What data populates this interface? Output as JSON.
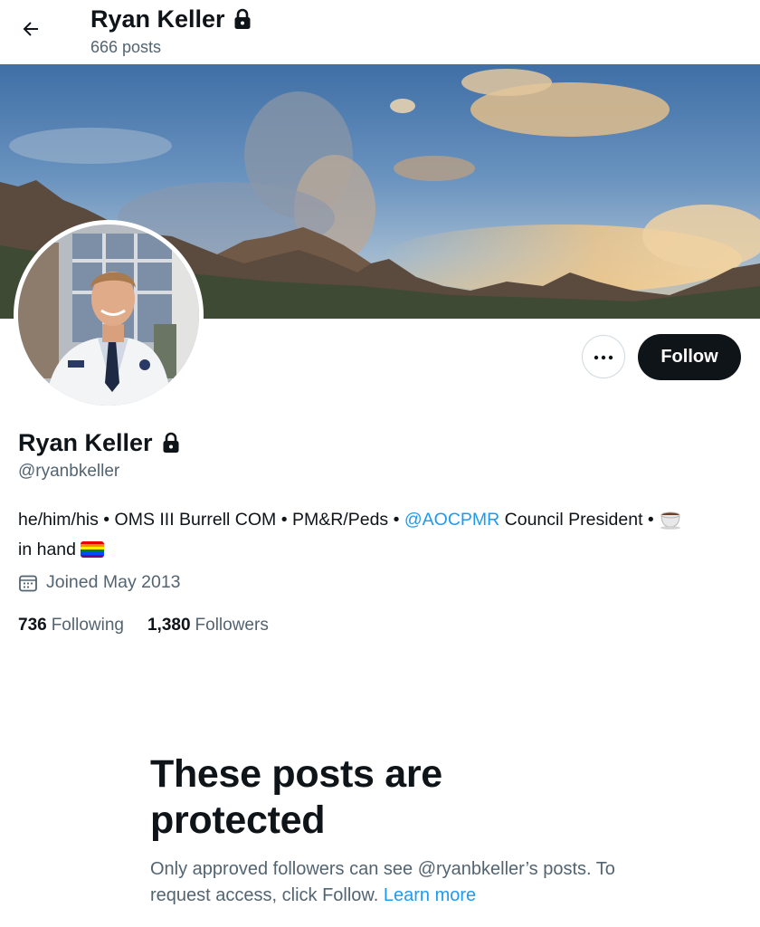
{
  "header": {
    "title": "Ryan Keller",
    "posts_count": "666 posts",
    "back_icon": "arrow-left-icon",
    "lock_icon": "lock-icon"
  },
  "profile": {
    "name": "Ryan Keller",
    "handle": "@ryanbkeller",
    "bio_part1": "he/him/his • OMS III Burrell COM • PM&R/Peds • ",
    "bio_mention": "@AOCPMR",
    "bio_part2": " Council President • ",
    "bio_part3": "in hand",
    "joined": "Joined May 2013",
    "following_count": "736",
    "following_label": "Following",
    "followers_count": "1,380",
    "followers_label": "Followers"
  },
  "actions": {
    "more_icon": "more-icon",
    "follow_label": "Follow"
  },
  "protected": {
    "title": "These posts are protected",
    "body": "Only approved followers can see @ryanbkeller’s posts. To request access, click Follow.",
    "link": "Learn more"
  },
  "colors": {
    "accent": "#1d9bf0",
    "text": "#0f1419",
    "secondary": "#536471",
    "button": "#0f1419"
  }
}
